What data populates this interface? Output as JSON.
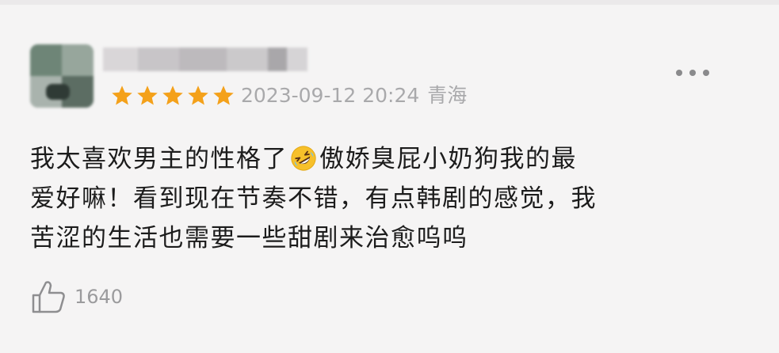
{
  "review": {
    "rating": 5,
    "rating_max": 5,
    "date": "2023-09-12 20:24",
    "location": "青海",
    "text_lines": [
      {
        "before": "我太喜欢男主的性格了",
        "emoji": "rolling-on-floor-laughing-emoji",
        "after": "傲娇臭屁小奶狗我的最"
      },
      {
        "text": "爱好嘛！看到现在节奏不错，有点韩剧的感觉，我"
      },
      {
        "text": "苦涩的生活也需要一些甜剧来治愈呜呜"
      }
    ],
    "likes": "1640"
  },
  "colors": {
    "star": "#f4a11a",
    "meta_text": "#a9a9ab",
    "body_text": "#1c1c1c",
    "background": "#f5f4f4"
  },
  "icons": {
    "more": "more-dots-icon",
    "like": "thumbs-up-icon"
  }
}
